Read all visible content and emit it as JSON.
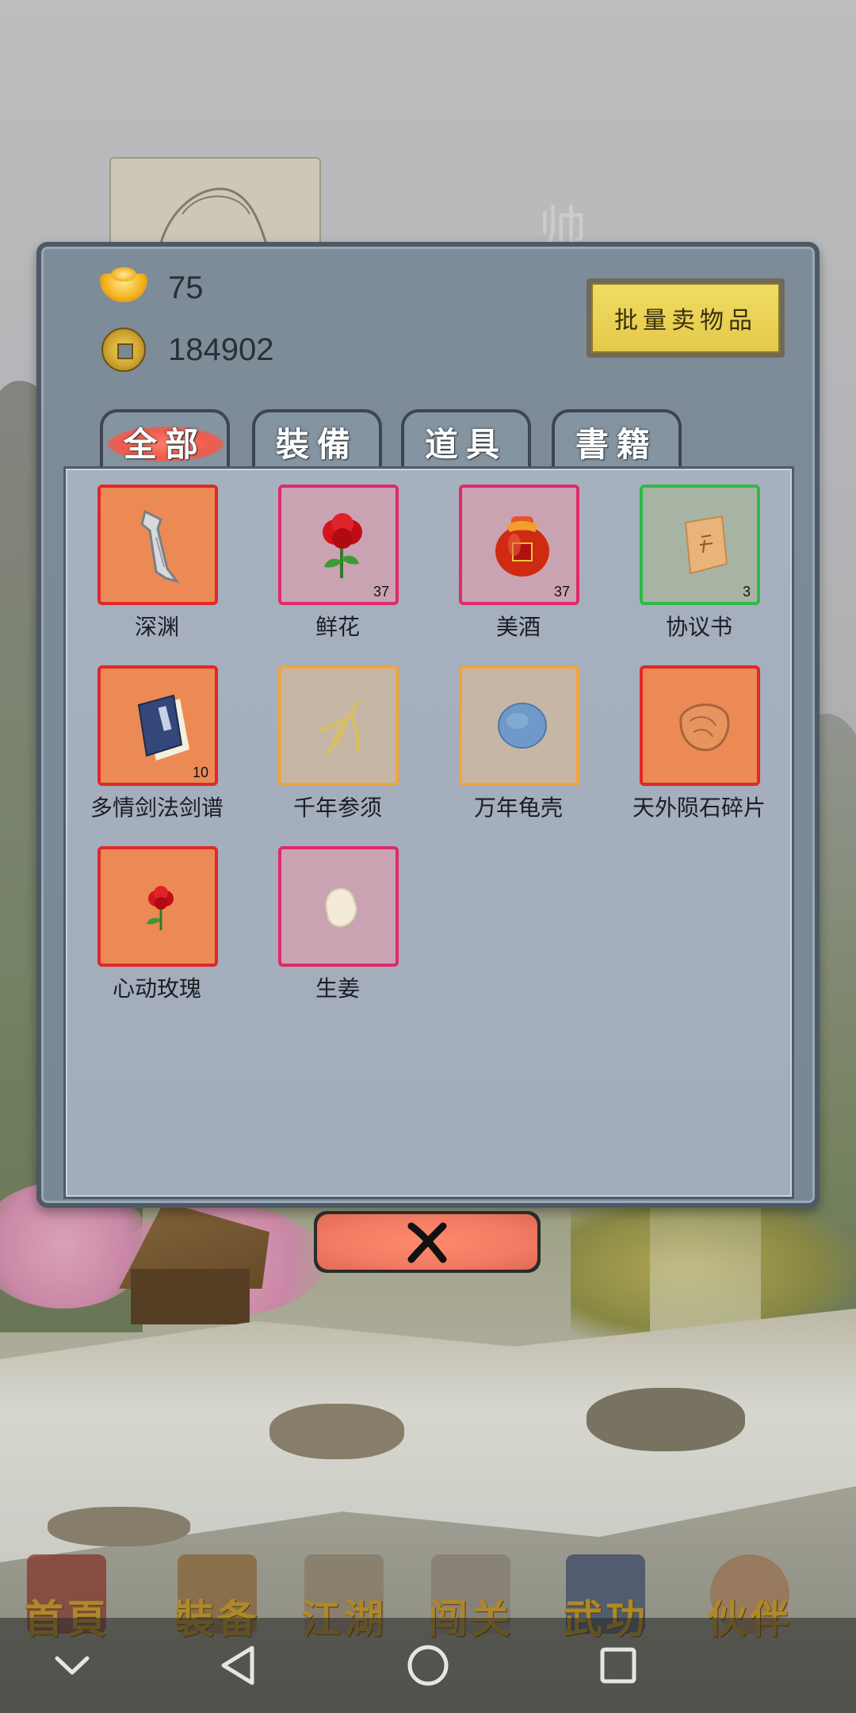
{
  "background": {
    "overlay_char": "帅"
  },
  "currency": {
    "ingot_value": "75",
    "coin_value": "184902"
  },
  "actions": {
    "batch_sell_label": "批量卖物品"
  },
  "tabs": [
    {
      "label": "全部",
      "active": true
    },
    {
      "label": "裝備",
      "active": false
    },
    {
      "label": "道具",
      "active": false
    },
    {
      "label": "書籍",
      "active": false
    }
  ],
  "items": [
    {
      "name": "深渊",
      "count": "",
      "rarity": "red",
      "icon": "sword-icon"
    },
    {
      "name": "鲜花",
      "count": "37",
      "rarity": "pink",
      "icon": "rose-icon"
    },
    {
      "name": "美酒",
      "count": "37",
      "rarity": "pink",
      "icon": "wine-jar-icon"
    },
    {
      "name": "协议书",
      "count": "3",
      "rarity": "green",
      "icon": "scroll-paper-icon"
    },
    {
      "name": "多情剑法剑谱",
      "count": "10",
      "rarity": "red",
      "icon": "book-icon"
    },
    {
      "name": "千年参须",
      "count": "",
      "rarity": "orange",
      "icon": "ginseng-icon"
    },
    {
      "name": "万年龟壳",
      "count": "",
      "rarity": "orange",
      "icon": "turtle-shell-icon"
    },
    {
      "name": "天外陨石碎片",
      "count": "",
      "rarity": "red",
      "icon": "meteorite-icon"
    },
    {
      "name": "心动玫瑰",
      "count": "",
      "rarity": "red",
      "icon": "rose-icon"
    },
    {
      "name": "生姜",
      "count": "",
      "rarity": "pink",
      "icon": "ginger-icon"
    }
  ],
  "bottom_nav": [
    {
      "label": "首頁"
    },
    {
      "label": "裝备"
    },
    {
      "label": "江湖"
    },
    {
      "label": "闯关"
    },
    {
      "label": "武功"
    },
    {
      "label": "伙伴"
    }
  ]
}
